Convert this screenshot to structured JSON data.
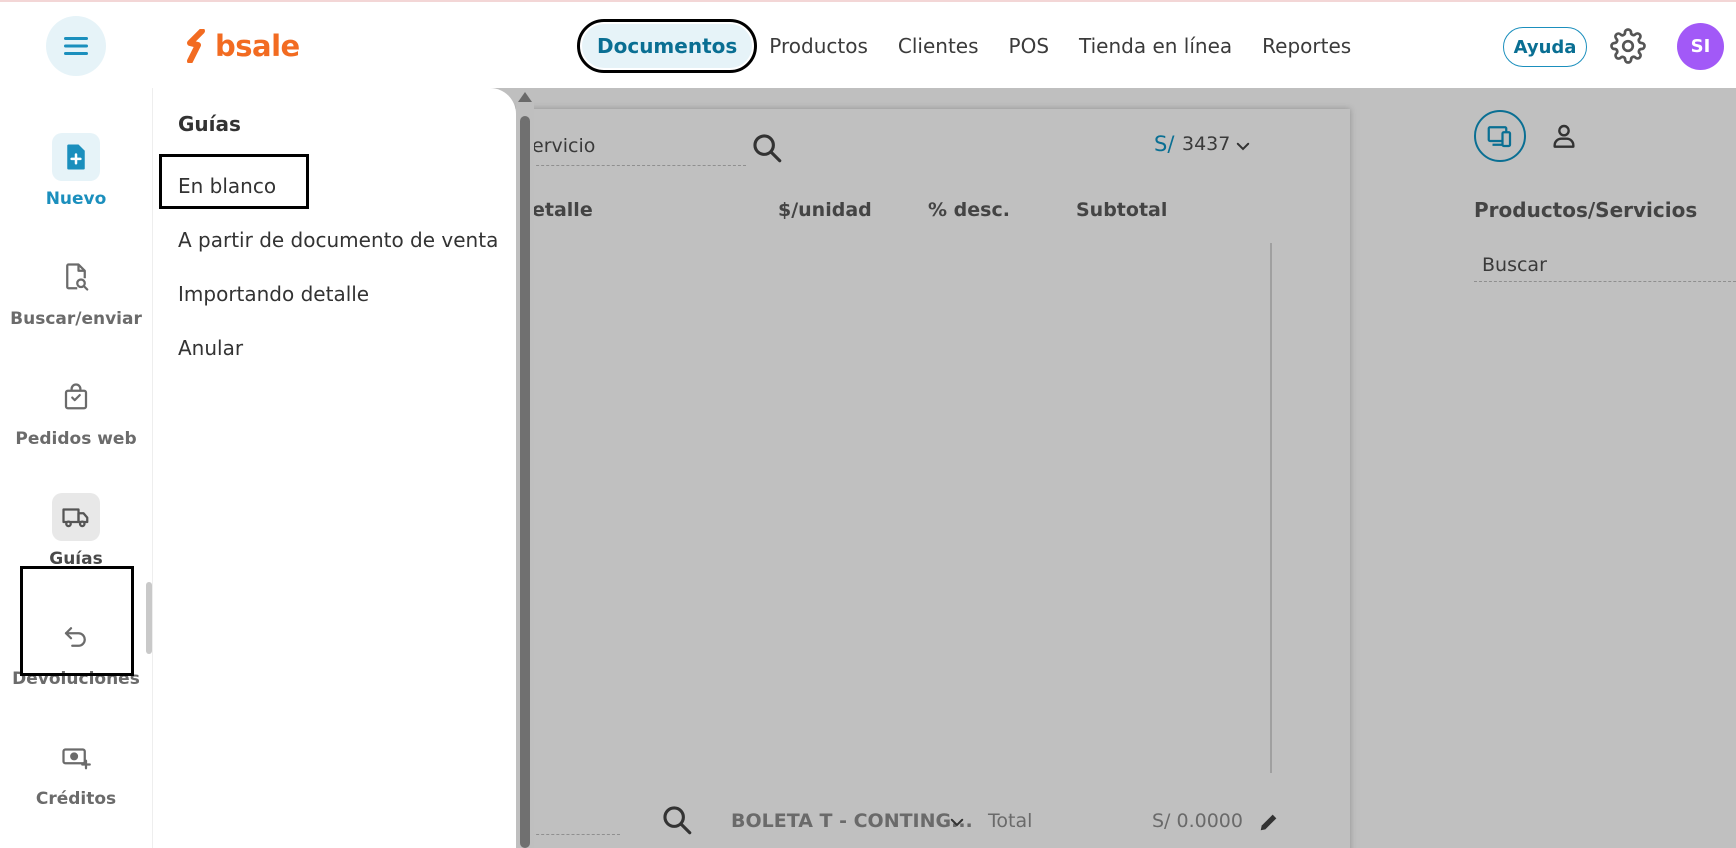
{
  "brand": {
    "logo_text": "bsale",
    "color": "#f26b21"
  },
  "topnav": {
    "items": [
      {
        "label": "Documentos"
      },
      {
        "label": "Productos"
      },
      {
        "label": "Clientes"
      },
      {
        "label": "POS"
      },
      {
        "label": "Tienda en línea"
      },
      {
        "label": "Reportes"
      }
    ],
    "help_label": "Ayuda",
    "avatar_initials": "SI"
  },
  "rail": {
    "items": [
      {
        "label": "Nuevo",
        "icon": "file-plus-icon"
      },
      {
        "label": "Buscar/enviar",
        "icon": "file-search-icon"
      },
      {
        "label": "Pedidos web",
        "icon": "shopping-bag-icon"
      },
      {
        "label": "Guías",
        "icon": "truck-icon"
      },
      {
        "label": "Devoluciones",
        "icon": "return-arrow-icon"
      },
      {
        "label": "Créditos",
        "icon": "cash-plus-icon"
      }
    ]
  },
  "submenu": {
    "title": "Guías",
    "items": [
      {
        "label": "En blanco"
      },
      {
        "label": "A partir de documento de venta"
      },
      {
        "label": "Importando detalle"
      },
      {
        "label": "Anular"
      }
    ]
  },
  "document": {
    "search_placeholder_partial": "ervicio",
    "currency_symbol": "S/",
    "price_list_value": "3437",
    "columns": [
      "etalle",
      "$/unidad",
      "% desc.",
      "Subtotal"
    ],
    "doc_type": "BOLETA T - CONTING...",
    "total_label": "Total",
    "total_value": "S/ 0.0000"
  },
  "right_panel": {
    "title": "Productos/Servicios",
    "search_placeholder": "Buscar"
  },
  "colors": {
    "accent": "#1b8fbd",
    "accent_dark": "#0a6f93",
    "avatar": "#a259f7",
    "overlay": "#bfbfbf"
  }
}
